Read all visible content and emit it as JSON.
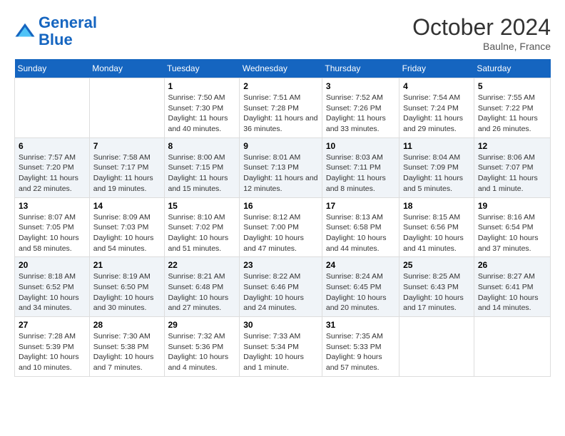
{
  "header": {
    "logo_line1": "General",
    "logo_line2": "Blue",
    "month": "October 2024",
    "location": "Baulne, France"
  },
  "columns": [
    "Sunday",
    "Monday",
    "Tuesday",
    "Wednesday",
    "Thursday",
    "Friday",
    "Saturday"
  ],
  "weeks": [
    [
      {
        "day": "",
        "info": ""
      },
      {
        "day": "",
        "info": ""
      },
      {
        "day": "1",
        "info": "Sunrise: 7:50 AM\nSunset: 7:30 PM\nDaylight: 11 hours and 40 minutes."
      },
      {
        "day": "2",
        "info": "Sunrise: 7:51 AM\nSunset: 7:28 PM\nDaylight: 11 hours and 36 minutes."
      },
      {
        "day": "3",
        "info": "Sunrise: 7:52 AM\nSunset: 7:26 PM\nDaylight: 11 hours and 33 minutes."
      },
      {
        "day": "4",
        "info": "Sunrise: 7:54 AM\nSunset: 7:24 PM\nDaylight: 11 hours and 29 minutes."
      },
      {
        "day": "5",
        "info": "Sunrise: 7:55 AM\nSunset: 7:22 PM\nDaylight: 11 hours and 26 minutes."
      }
    ],
    [
      {
        "day": "6",
        "info": "Sunrise: 7:57 AM\nSunset: 7:20 PM\nDaylight: 11 hours and 22 minutes."
      },
      {
        "day": "7",
        "info": "Sunrise: 7:58 AM\nSunset: 7:17 PM\nDaylight: 11 hours and 19 minutes."
      },
      {
        "day": "8",
        "info": "Sunrise: 8:00 AM\nSunset: 7:15 PM\nDaylight: 11 hours and 15 minutes."
      },
      {
        "day": "9",
        "info": "Sunrise: 8:01 AM\nSunset: 7:13 PM\nDaylight: 11 hours and 12 minutes."
      },
      {
        "day": "10",
        "info": "Sunrise: 8:03 AM\nSunset: 7:11 PM\nDaylight: 11 hours and 8 minutes."
      },
      {
        "day": "11",
        "info": "Sunrise: 8:04 AM\nSunset: 7:09 PM\nDaylight: 11 hours and 5 minutes."
      },
      {
        "day": "12",
        "info": "Sunrise: 8:06 AM\nSunset: 7:07 PM\nDaylight: 11 hours and 1 minute."
      }
    ],
    [
      {
        "day": "13",
        "info": "Sunrise: 8:07 AM\nSunset: 7:05 PM\nDaylight: 10 hours and 58 minutes."
      },
      {
        "day": "14",
        "info": "Sunrise: 8:09 AM\nSunset: 7:03 PM\nDaylight: 10 hours and 54 minutes."
      },
      {
        "day": "15",
        "info": "Sunrise: 8:10 AM\nSunset: 7:02 PM\nDaylight: 10 hours and 51 minutes."
      },
      {
        "day": "16",
        "info": "Sunrise: 8:12 AM\nSunset: 7:00 PM\nDaylight: 10 hours and 47 minutes."
      },
      {
        "day": "17",
        "info": "Sunrise: 8:13 AM\nSunset: 6:58 PM\nDaylight: 10 hours and 44 minutes."
      },
      {
        "day": "18",
        "info": "Sunrise: 8:15 AM\nSunset: 6:56 PM\nDaylight: 10 hours and 41 minutes."
      },
      {
        "day": "19",
        "info": "Sunrise: 8:16 AM\nSunset: 6:54 PM\nDaylight: 10 hours and 37 minutes."
      }
    ],
    [
      {
        "day": "20",
        "info": "Sunrise: 8:18 AM\nSunset: 6:52 PM\nDaylight: 10 hours and 34 minutes."
      },
      {
        "day": "21",
        "info": "Sunrise: 8:19 AM\nSunset: 6:50 PM\nDaylight: 10 hours and 30 minutes."
      },
      {
        "day": "22",
        "info": "Sunrise: 8:21 AM\nSunset: 6:48 PM\nDaylight: 10 hours and 27 minutes."
      },
      {
        "day": "23",
        "info": "Sunrise: 8:22 AM\nSunset: 6:46 PM\nDaylight: 10 hours and 24 minutes."
      },
      {
        "day": "24",
        "info": "Sunrise: 8:24 AM\nSunset: 6:45 PM\nDaylight: 10 hours and 20 minutes."
      },
      {
        "day": "25",
        "info": "Sunrise: 8:25 AM\nSunset: 6:43 PM\nDaylight: 10 hours and 17 minutes."
      },
      {
        "day": "26",
        "info": "Sunrise: 8:27 AM\nSunset: 6:41 PM\nDaylight: 10 hours and 14 minutes."
      }
    ],
    [
      {
        "day": "27",
        "info": "Sunrise: 7:28 AM\nSunset: 5:39 PM\nDaylight: 10 hours and 10 minutes."
      },
      {
        "day": "28",
        "info": "Sunrise: 7:30 AM\nSunset: 5:38 PM\nDaylight: 10 hours and 7 minutes."
      },
      {
        "day": "29",
        "info": "Sunrise: 7:32 AM\nSunset: 5:36 PM\nDaylight: 10 hours and 4 minutes."
      },
      {
        "day": "30",
        "info": "Sunrise: 7:33 AM\nSunset: 5:34 PM\nDaylight: 10 hours and 1 minute."
      },
      {
        "day": "31",
        "info": "Sunrise: 7:35 AM\nSunset: 5:33 PM\nDaylight: 9 hours and 57 minutes."
      },
      {
        "day": "",
        "info": ""
      },
      {
        "day": "",
        "info": ""
      }
    ]
  ]
}
